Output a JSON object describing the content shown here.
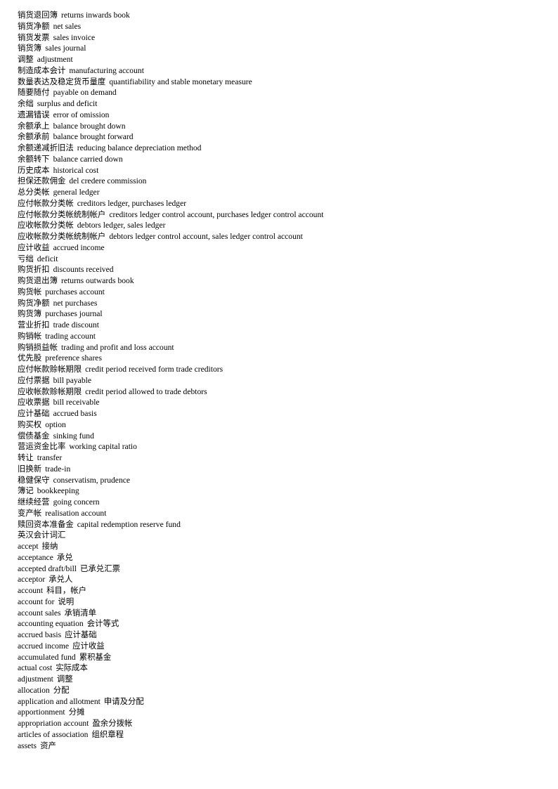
{
  "document": {
    "sections": [
      {
        "id": "chinese-to-english",
        "heading": null,
        "direction": "cn-en",
        "entries": [
          {
            "term": "销货退回簿",
            "gloss": "returns inwards book"
          },
          {
            "term": "销货净额",
            "gloss": "net sales"
          },
          {
            "term": "销货发票",
            "gloss": "sales invoice"
          },
          {
            "term": "销货簿",
            "gloss": "sales journal"
          },
          {
            "term": "调整",
            "gloss": "adjustment"
          },
          {
            "term": "制造成本会计",
            "gloss": "manufacturing account"
          },
          {
            "term": "数量表达及稳定货币量度",
            "gloss": "quantifiability and stable monetary measure"
          },
          {
            "term": "随要随付",
            "gloss": "payable on demand"
          },
          {
            "term": "余绌",
            "gloss": "surplus and deficit"
          },
          {
            "term": "遗漏错误",
            "gloss": "error of omission"
          },
          {
            "term": "余额承上",
            "gloss": "balance brought down"
          },
          {
            "term": "余额承前",
            "gloss": "balance brought forward"
          },
          {
            "term": "余额递减折旧法",
            "gloss": "reducing balance depreciation method"
          },
          {
            "term": "余额转下",
            "gloss": "balance carried down"
          },
          {
            "term": "历史成本",
            "gloss": "historical cost"
          },
          {
            "term": "担保还款佣金",
            "gloss": "del credere commission"
          },
          {
            "term": "总分类帐",
            "gloss": "general ledger"
          },
          {
            "term": "应付帐款分类帐",
            "gloss": "creditors ledger, purchases ledger"
          },
          {
            "term": "应付帐款分类帐统制帐户",
            "gloss": "creditors ledger control account, purchases ledger control account"
          },
          {
            "term": "应收帐款分类帐",
            "gloss": "debtors ledger, sales ledger"
          },
          {
            "term": "应收帐款分类帐统制帐户",
            "gloss": "debtors ledger control account, sales ledger control account"
          },
          {
            "term": "应计收益",
            "gloss": "accrued income"
          },
          {
            "term": "亏绌",
            "gloss": "deficit"
          },
          {
            "term": "购货折扣",
            "gloss": "discounts received"
          },
          {
            "term": "购货退出簿",
            "gloss": "returns outwards book"
          },
          {
            "term": "购货帐",
            "gloss": "purchases account"
          },
          {
            "term": "购货净额",
            "gloss": "net purchases"
          },
          {
            "term": "购货簿",
            "gloss": "purchases journal"
          },
          {
            "term": "营业折扣",
            "gloss": "trade discount"
          },
          {
            "term": "购销帐",
            "gloss": "trading account"
          },
          {
            "term": "购销损益帐",
            "gloss": "trading and profit and loss account"
          },
          {
            "term": "优先股",
            "gloss": "preference shares"
          },
          {
            "term": "应付帐款赊帐期限",
            "gloss": "credit period received form trade creditors"
          },
          {
            "term": "应付票据",
            "gloss": "bill payable"
          },
          {
            "term": "应收帐款赊帐期限",
            "gloss": "credit period allowed to trade debtors"
          },
          {
            "term": "应收票据",
            "gloss": "bill receivable"
          },
          {
            "term": "应计基础",
            "gloss": "accrued basis"
          },
          {
            "term": "购买权",
            "gloss": "option"
          },
          {
            "term": "偿债基金",
            "gloss": "sinking fund"
          },
          {
            "term": "营运资金比率",
            "gloss": "working capital ratio"
          },
          {
            "term": "转让",
            "gloss": "transfer"
          },
          {
            "term": "旧换新",
            "gloss": "trade-in"
          },
          {
            "term": "稳健保守",
            "gloss": "conservatism, prudence"
          },
          {
            "term": "簿记",
            "gloss": "bookkeeping"
          },
          {
            "term": "继续经营",
            "gloss": "going concern"
          },
          {
            "term": "变产帐",
            "gloss": "realisation account"
          },
          {
            "term": "赎回资本准备金",
            "gloss": "capital redemption reserve fund"
          }
        ]
      },
      {
        "id": "english-to-chinese",
        "heading": "英汉会计词汇",
        "direction": "en-cn",
        "entries": [
          {
            "term": "accept",
            "gloss": "接纳"
          },
          {
            "term": "acceptance",
            "gloss": "承兑"
          },
          {
            "term": "accepted draft/bill",
            "gloss": "已承兑汇票"
          },
          {
            "term": "acceptor",
            "gloss": "承兑人"
          },
          {
            "term": "account",
            "gloss": "科目，帐户"
          },
          {
            "term": "account for",
            "gloss": "说明"
          },
          {
            "term": "account sales",
            "gloss": "承销清单"
          },
          {
            "term": "accounting equation",
            "gloss": "会计等式"
          },
          {
            "term": "accrued basis",
            "gloss": "应计基础"
          },
          {
            "term": "accrued income",
            "gloss": "应计收益"
          },
          {
            "term": "accumulated fund",
            "gloss": "累积基金"
          },
          {
            "term": "actual cost",
            "gloss": "实际成本"
          },
          {
            "term": "adjustment",
            "gloss": "调整"
          },
          {
            "term": "allocation",
            "gloss": "分配"
          },
          {
            "term": "application and allotment",
            "gloss": "申请及分配"
          },
          {
            "term": "apportionment",
            "gloss": "分摊"
          },
          {
            "term": "appropriation account",
            "gloss": "盈余分拨帐"
          },
          {
            "term": "articles of association",
            "gloss": "组织章程"
          },
          {
            "term": "assets",
            "gloss": "资产"
          }
        ]
      }
    ]
  }
}
